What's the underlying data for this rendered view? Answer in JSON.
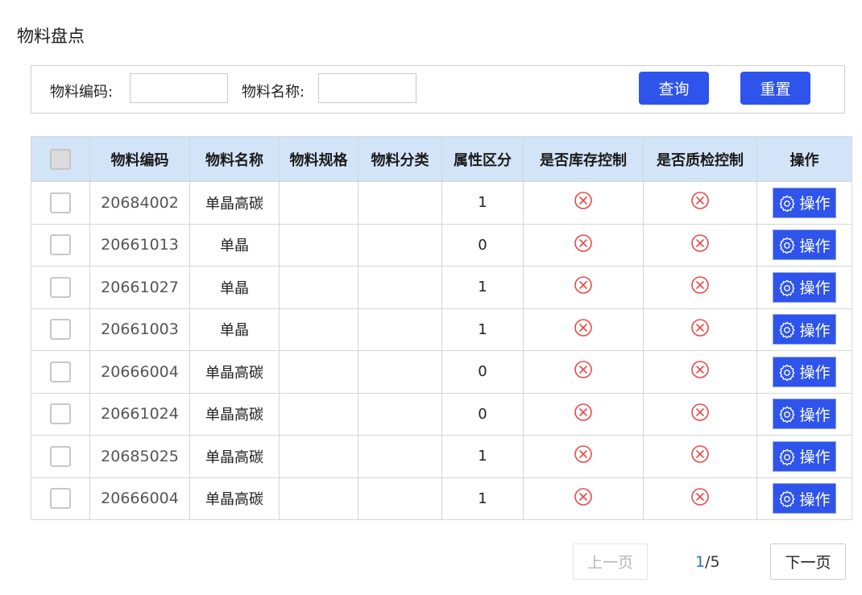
{
  "page": {
    "title": "物料盘点"
  },
  "search": {
    "code_label": "物料编码:",
    "code_value": "",
    "name_label": "物料名称:",
    "name_value": "",
    "query_label": "查询",
    "reset_label": "重置"
  },
  "table": {
    "columns": [
      "",
      "物料编码",
      "物料名称",
      "物料规格",
      "物料分类",
      "属性区分",
      "是否库存控制",
      "是否质检控制",
      "操作"
    ],
    "rows": [
      {
        "code": "20684002",
        "name": "单晶高碳",
        "spec": "",
        "category": "",
        "attr": "1",
        "stock_ctrl": "x-circle-icon",
        "qc_ctrl": "x-circle-icon",
        "action": "操作"
      },
      {
        "code": "20661013",
        "name": "单晶",
        "spec": "",
        "category": "",
        "attr": "0",
        "stock_ctrl": "x-circle-icon",
        "qc_ctrl": "x-circle-icon",
        "action": "操作"
      },
      {
        "code": "20661027",
        "name": "单晶",
        "spec": "",
        "category": "",
        "attr": "1",
        "stock_ctrl": "x-circle-icon",
        "qc_ctrl": "x-circle-icon",
        "action": "操作"
      },
      {
        "code": "20661003",
        "name": "单晶",
        "spec": "",
        "category": "",
        "attr": "1",
        "stock_ctrl": "x-circle-icon",
        "qc_ctrl": "x-circle-icon",
        "action": "操作"
      },
      {
        "code": "20666004",
        "name": "单晶高碳",
        "spec": "",
        "category": "",
        "attr": "0",
        "stock_ctrl": "x-circle-icon",
        "qc_ctrl": "x-circle-icon",
        "action": "操作"
      },
      {
        "code": "20661024",
        "name": "单晶高碳",
        "spec": "",
        "category": "",
        "attr": "0",
        "stock_ctrl": "x-circle-icon",
        "qc_ctrl": "x-circle-icon",
        "action": "操作"
      },
      {
        "code": "20685025",
        "name": "单晶高碳",
        "spec": "",
        "category": "",
        "attr": "1",
        "stock_ctrl": "x-circle-icon",
        "qc_ctrl": "x-circle-icon",
        "action": "操作"
      },
      {
        "code": "20666004",
        "name": "单晶高碳",
        "spec": "",
        "category": "",
        "attr": "1",
        "stock_ctrl": "x-circle-icon",
        "qc_ctrl": "x-circle-icon",
        "action": "操作"
      }
    ]
  },
  "pagination": {
    "prev_label": "上一页",
    "next_label": "下一页",
    "current": "1",
    "total": "/5"
  },
  "colors": {
    "primary": "#2f54eb",
    "header_bg": "#d3e4f8",
    "error_icon": "#e84a4a"
  }
}
